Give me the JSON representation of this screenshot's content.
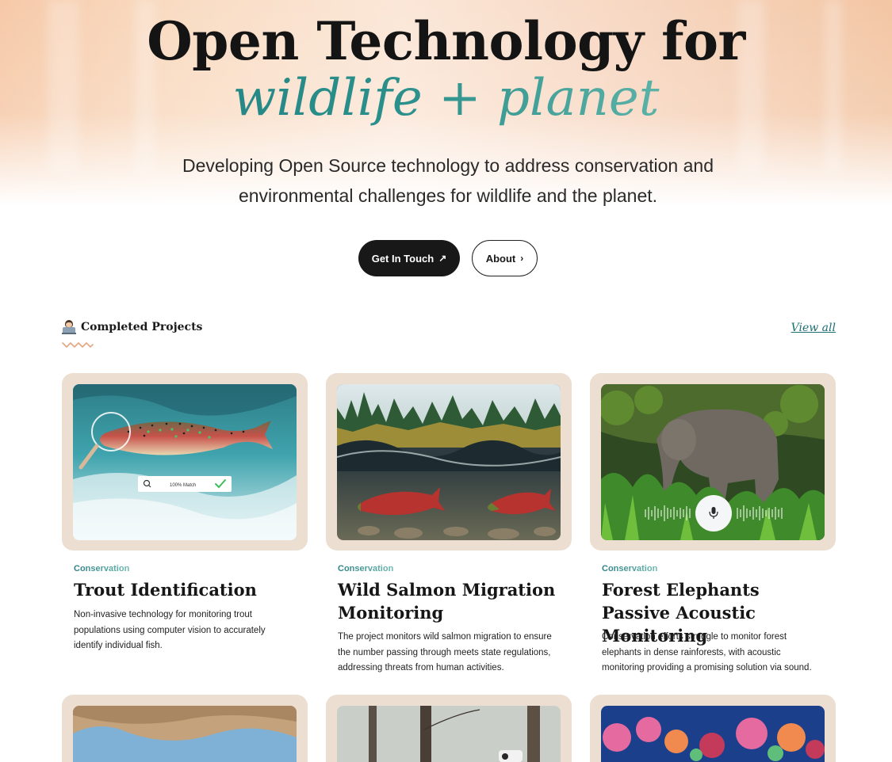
{
  "hero": {
    "title": "Open Technology for",
    "subtitle": "wildlife + planet",
    "description": "Developing Open Source technology to address conservation and environmental challenges for wildlife and the planet.",
    "primary_button": "Get In Touch",
    "secondary_button": "About"
  },
  "section": {
    "title": "Completed Projects",
    "view_all": "View all"
  },
  "projects": [
    {
      "category": "Conservation",
      "title": "Trout Identification",
      "description": "Non-invasive technology for monitoring trout populations using computer vision to accurately identify individual fish.",
      "overlay_text": "100% Match"
    },
    {
      "category": "Conservation",
      "title": "Wild Salmon Migration Monitoring",
      "description": "The project monitors wild salmon migration to ensure the number passing through meets state regulations, addressing threats from human activities."
    },
    {
      "category": "Conservation",
      "title": "Forest Elephants Passive Acoustic Monitoring",
      "description": "Conservation efforts struggle to monitor forest elephants in dense rainforests, with acoustic monitoring providing a promising solution via sound."
    }
  ],
  "colors": {
    "accent_teal": "#2b8f8b",
    "button_dark": "#181818",
    "card_frame": "#ecdfd2"
  }
}
